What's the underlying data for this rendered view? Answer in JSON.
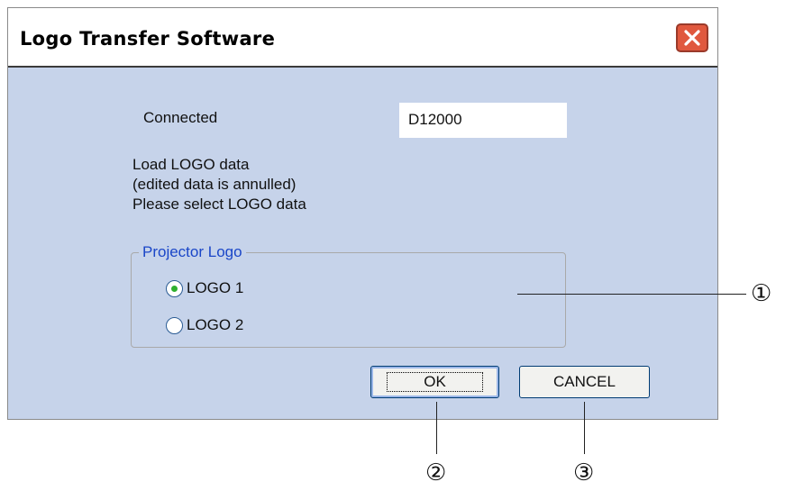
{
  "window": {
    "title": "Logo Transfer Software",
    "close_icon": "close-icon"
  },
  "connection": {
    "label": "Connected",
    "model": "D12000"
  },
  "message": [
    "Load LOGO data",
    "(edited data is annulled)",
    "Please select LOGO data"
  ],
  "logo_group": {
    "legend": "Projector Logo",
    "options": [
      {
        "label": "LOGO 1",
        "checked": true
      },
      {
        "label": "LOGO 2",
        "checked": false
      }
    ]
  },
  "buttons": {
    "ok": "OK",
    "cancel": "CANCEL"
  },
  "callouts": [
    "①",
    "②",
    "③"
  ],
  "colors": {
    "dialog_bg": "#c6d3ea",
    "close_red": "#e0583e",
    "legend_blue": "#1a46c8",
    "radio_green": "#2fb02f"
  }
}
